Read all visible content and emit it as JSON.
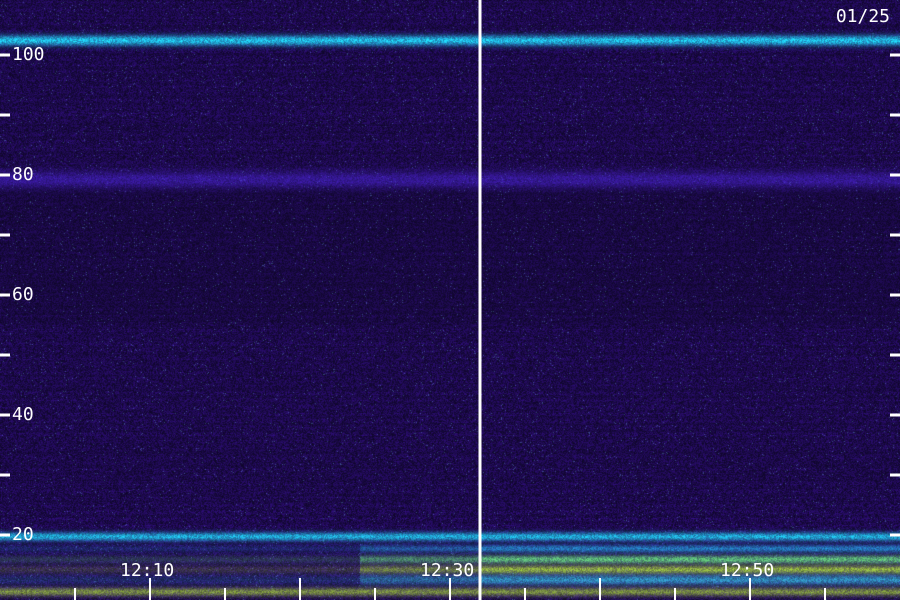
{
  "date_label": "01/25",
  "y_axis": {
    "min": 10,
    "max": 108,
    "labeled_ticks": [
      "100",
      "80",
      "60",
      "40",
      "20"
    ],
    "labeled_values": [
      100,
      80,
      60,
      40,
      20
    ],
    "minor_values": [
      90,
      70,
      50,
      30
    ]
  },
  "x_axis": {
    "time_labels": [
      "12:10",
      "12:30",
      "12:50"
    ],
    "time_label_minutes": [
      10,
      30,
      50
    ],
    "minute_start": 0,
    "minute_end": 60,
    "tick_interval_minutes": 5
  },
  "marker_line_minute": 32,
  "colors": {
    "background": "#0c0628",
    "noise": "#2a14a0",
    "band_bright": "#22d8ff",
    "band_hot": "#c8ff3a",
    "axis": "#ffffff"
  }
}
